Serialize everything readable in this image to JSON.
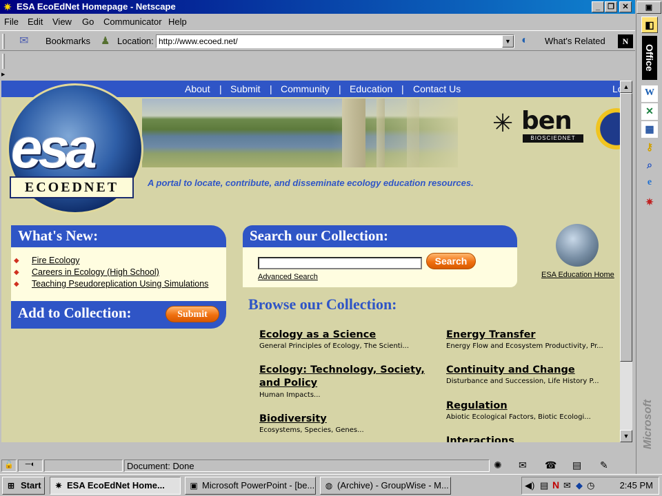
{
  "window": {
    "title": "ESA EcoEdNet Homepage - Netscape",
    "min": "_",
    "max": "❐",
    "close": "✕"
  },
  "menu": [
    "File",
    "Edit",
    "View",
    "Go",
    "Communicator",
    "Help"
  ],
  "toolbar": {
    "bookmarks": "Bookmarks",
    "location_label": "Location:",
    "url": "http://www.ecoed.net/",
    "whats_related": "What's Related"
  },
  "nav": [
    "About",
    "|",
    "Submit",
    "|",
    "Community",
    "|",
    "Education",
    "|",
    "Contact Us",
    "Lo"
  ],
  "logo": {
    "esa": "esa",
    "ecoednet": "ECOEDNET",
    "ben": "ben",
    "ben_sub": "BIOSCIEDNET"
  },
  "tagline": "A portal to locate, contribute, and disseminate ecology education resources.",
  "whats_new": {
    "heading": "What's New:",
    "items": [
      "Fire Ecology",
      "Careers in Ecology (High School)",
      "Teaching Pseudoreplication Using Simulations"
    ]
  },
  "add": {
    "heading": "Add to Collection:",
    "button": "Submit"
  },
  "search": {
    "heading": "Search our Collection:",
    "button": "Search",
    "advanced": "Advanced Search",
    "value": ""
  },
  "edu_home": "ESA Education Home",
  "browse": {
    "heading": "Browse our Collection:",
    "left": [
      {
        "title": "Ecology as a Science",
        "desc": "General Principles of Ecology, The Scienti..."
      },
      {
        "title": "Ecology: Technology, Society, and Policy",
        "desc": "Human Impacts..."
      },
      {
        "title": "Biodiversity",
        "desc": "Ecosystems, Species, Genes..."
      }
    ],
    "right": [
      {
        "title": "Energy Transfer",
        "desc": "Energy Flow and Ecosystem Productivity, Pr..."
      },
      {
        "title": "Continuity and Change",
        "desc": "Disturbance and Succession, Life History P..."
      },
      {
        "title": "Regulation",
        "desc": "Abiotic Ecological Factors, Biotic Ecologi..."
      },
      {
        "title": "Interactions",
        "desc": ""
      }
    ]
  },
  "status": "Document: Done",
  "taskbar": {
    "start": "Start",
    "tasks": [
      "ESA EcoEdNet Home...",
      "Microsoft PowerPoint - [be...",
      "(Archive) - GroupWise - M..."
    ],
    "clock": "2:45 PM"
  },
  "office": {
    "title": "Office",
    "brand": "Microsoft"
  }
}
